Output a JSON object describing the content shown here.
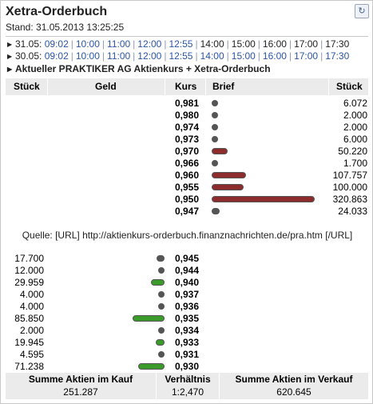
{
  "widget": {
    "title": "Xetra-Orderbuch",
    "stand": "Stand: 31.05.2013 13:25:25",
    "refresh_icon": "refresh-icon"
  },
  "timelines": [
    {
      "date": "31.05:",
      "times": [
        "09:02",
        "10:00",
        "11:00",
        "12:00",
        "12:55",
        "14:00",
        "15:00",
        "16:00",
        "17:00",
        "17:30"
      ],
      "linked": [
        true,
        true,
        true,
        true,
        true,
        false,
        false,
        false,
        false,
        false
      ]
    },
    {
      "date": "30.05:",
      "times": [
        "09:02",
        "10:00",
        "11:00",
        "12:00",
        "12:55",
        "14:00",
        "15:00",
        "16:00",
        "17:00",
        "17:30"
      ],
      "linked": [
        true,
        true,
        true,
        true,
        true,
        true,
        true,
        true,
        true,
        true
      ]
    }
  ],
  "section_title": "Aktueller PRAKTIKER AG Aktienkurs + Xetra-Orderbuch",
  "table_header": {
    "stueck_left": "Stück",
    "geld": "Geld",
    "kurs": "Kurs",
    "brief": "Brief",
    "stueck_right": "Stück"
  },
  "asks": [
    {
      "price": "0,981",
      "qty": "6.072",
      "bar": 0.019
    },
    {
      "price": "0,980",
      "qty": "2.000",
      "bar": 0.006
    },
    {
      "price": "0,974",
      "qty": "2.000",
      "bar": 0.006
    },
    {
      "price": "0,973",
      "qty": "6.000",
      "bar": 0.019
    },
    {
      "price": "0,970",
      "qty": "50.220",
      "bar": 0.157
    },
    {
      "price": "0,966",
      "qty": "1.700",
      "bar": 0.005
    },
    {
      "price": "0,960",
      "qty": "107.757",
      "bar": 0.336
    },
    {
      "price": "0,955",
      "qty": "100.000",
      "bar": 0.312
    },
    {
      "price": "0,950",
      "qty": "320.863",
      "bar": 1.0
    },
    {
      "price": "0,947",
      "qty": "24.033",
      "bar": 0.075
    }
  ],
  "source": "Quelle: [URL] http://aktienkurs-orderbuch.finanznachrichten.de/pra.htm [/URL]",
  "bids": [
    {
      "qty": "17.700",
      "price": "0,945",
      "bar": 0.248
    },
    {
      "qty": "12.000",
      "price": "0,944",
      "bar": 0.168
    },
    {
      "qty": "29.959",
      "price": "0,940",
      "bar": 0.42
    },
    {
      "qty": "4.000",
      "price": "0,937",
      "bar": 0.056
    },
    {
      "qty": "4.000",
      "price": "0,936",
      "bar": 0.056
    },
    {
      "qty": "85.850",
      "price": "0,935",
      "bar": 1.0
    },
    {
      "qty": "2.000",
      "price": "0,934",
      "bar": 0.028
    },
    {
      "qty": "19.945",
      "price": "0,933",
      "bar": 0.28
    },
    {
      "qty": "4.595",
      "price": "0,931",
      "bar": 0.064
    },
    {
      "qty": "71.238",
      "price": "0,930",
      "bar": 0.83
    }
  ],
  "footer": {
    "kauf_label": "Summe Aktien im Kauf",
    "kauf_value": "251.287",
    "verh_label": "Verhältnis",
    "verh_value": "1:2,470",
    "verkauf_label": "Summe Aktien im Verkauf",
    "verkauf_value": "620.645"
  },
  "colors": {
    "ask_bar": "#8c2c2c",
    "bid_bar": "#3a9a2a",
    "link": "#2a55a8"
  }
}
